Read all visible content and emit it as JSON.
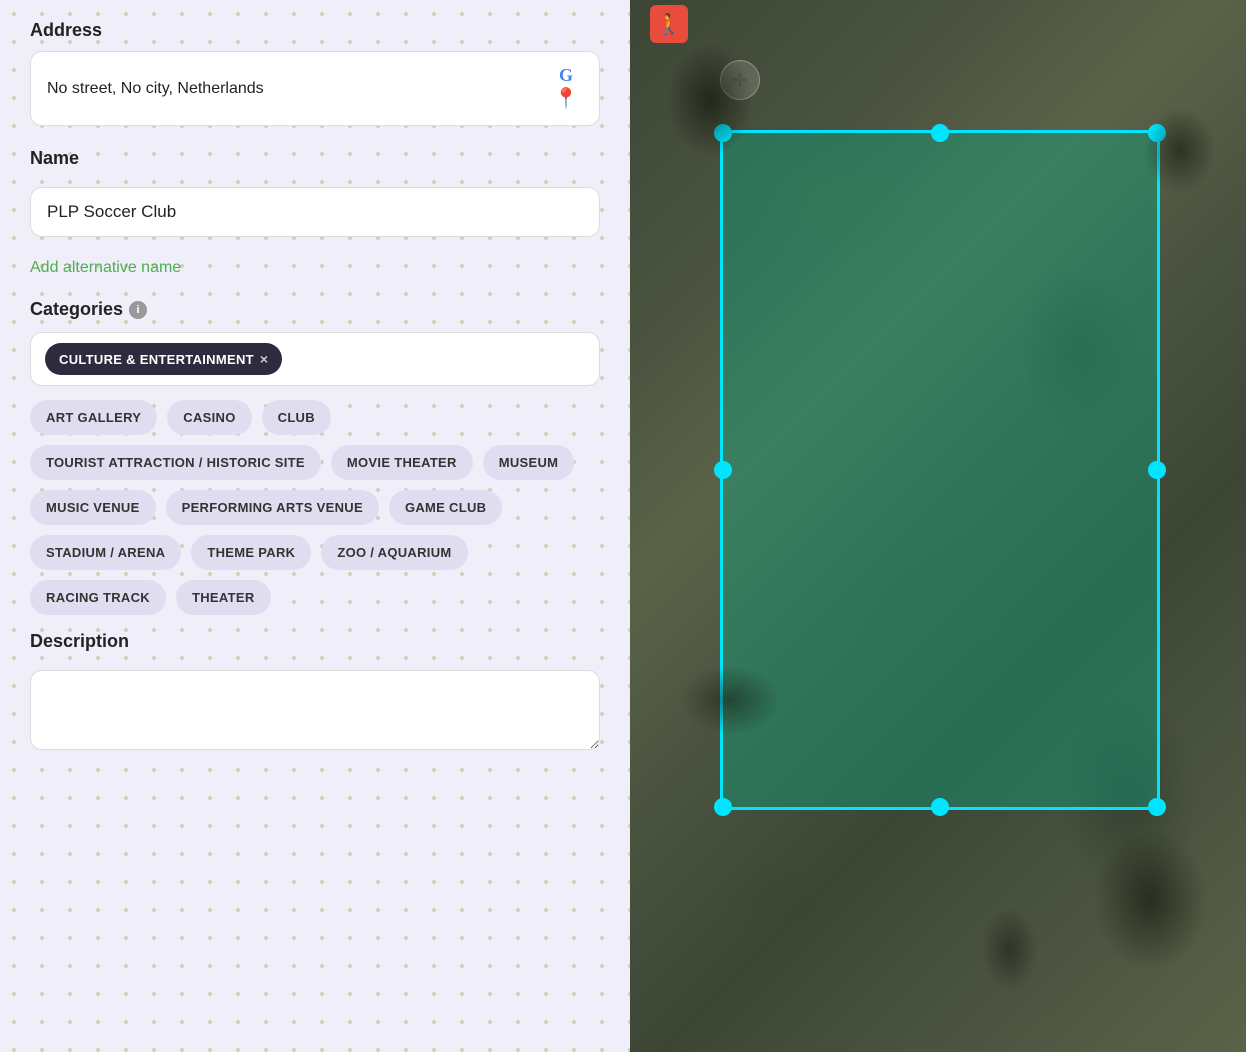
{
  "leftPanel": {
    "address": {
      "label": "Address",
      "value": "No street, No city, Netherlands"
    },
    "name": {
      "label": "Name",
      "value": "PLP Soccer Club"
    },
    "addAltName": "Add alternative name",
    "categories": {
      "label": "Categories",
      "selectedTag": "CULTURE & ENTERTAINMENT",
      "chips": [
        "ART GALLERY",
        "CASINO",
        "CLUB",
        "TOURIST ATTRACTION / HISTORIC SITE",
        "MOVIE THEATER",
        "MUSEUM",
        "MUSIC VENUE",
        "PERFORMING ARTS VENUE",
        "GAME CLUB",
        "STADIUM / ARENA",
        "THEME PARK",
        "ZOO / AQUARIUM",
        "RACING TRACK",
        "THEATER"
      ]
    },
    "description": {
      "label": "Description",
      "placeholder": ""
    }
  },
  "icons": {
    "google_g": "G",
    "map_pin": "📍",
    "info": "i",
    "close": "×",
    "move": "✛",
    "person": "🚶"
  }
}
